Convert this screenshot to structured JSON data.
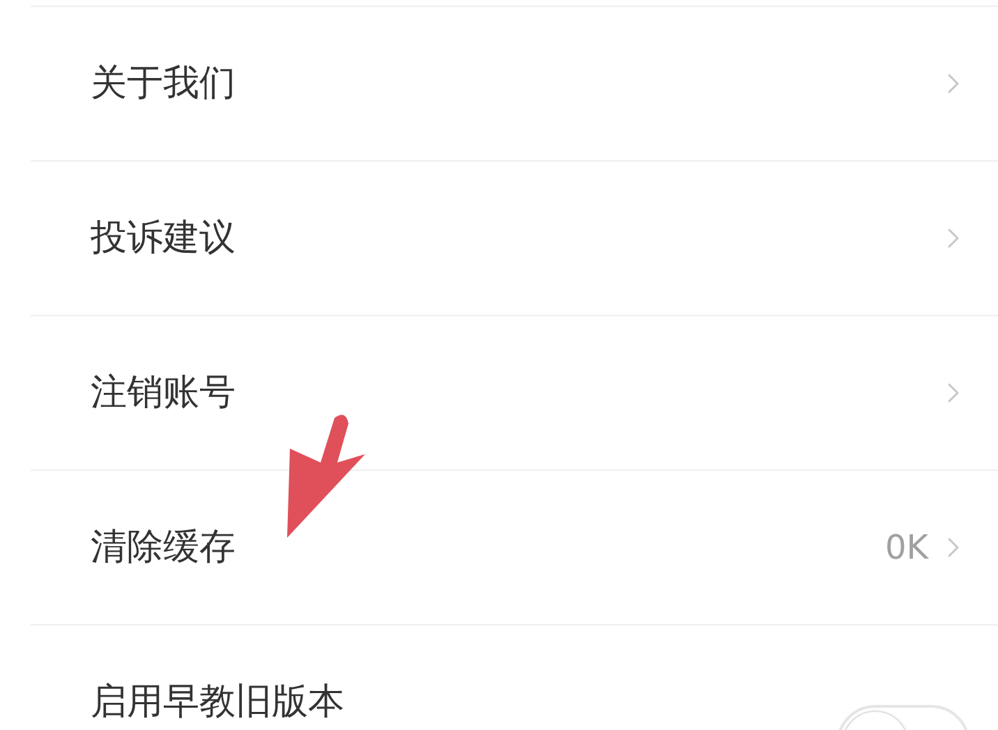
{
  "settings": [
    {
      "kind": "link",
      "label": "关于我们"
    },
    {
      "kind": "link",
      "label": "投诉建议"
    },
    {
      "kind": "link",
      "label": "注销账号"
    },
    {
      "kind": "link",
      "label": "清除缓存",
      "value": "0K"
    },
    {
      "kind": "toggle",
      "label": "启用早教旧版本",
      "on": false
    }
  ]
}
